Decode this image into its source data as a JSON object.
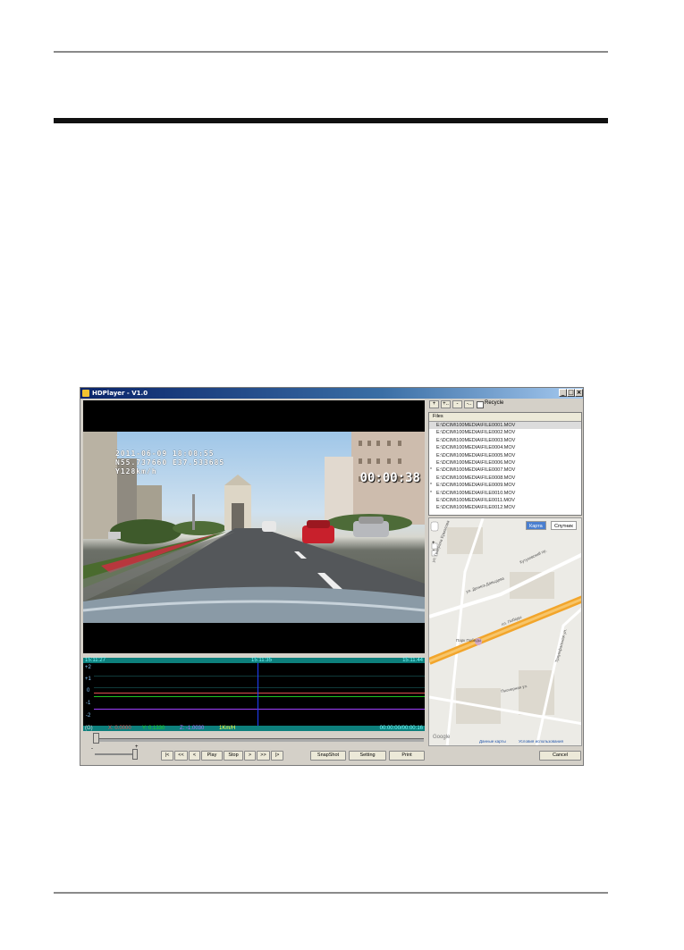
{
  "window": {
    "title": "HDPlayer - V1.0",
    "min": "_",
    "max": "□",
    "close": "×"
  },
  "video": {
    "osd_lines": [
      "2011-06-09 18:08:55",
      "N55.737660 E37.533685",
      "Y128km/h"
    ],
    "timecode": "00:00:38"
  },
  "graph": {
    "time_left": "15:11:27",
    "time_mid": "15:11:35",
    "time_right": "15:11:44",
    "y_ticks": [
      "+2",
      "+1",
      "0",
      "-1",
      "-2"
    ],
    "status": {
      "g_label": "(G)",
      "x_val": "X: 0.0000",
      "y_val": "Y: 0.1330",
      "z_val": "Z: -1.0030",
      "speed": "1Km/H",
      "range": "00:00:00/00:00:16"
    }
  },
  "volume": {
    "minus": "-",
    "plus": "+"
  },
  "controls": {
    "first": "|<",
    "rewind": "<<",
    "back": "<",
    "play": "Play",
    "stop": "Stop",
    "forward": ">",
    "fast_forward": ">>",
    "last": "|>",
    "snapshot": "SnapShot",
    "setting": "Setting",
    "print": "Print",
    "cancel": "Cancel"
  },
  "file_toolbar": {
    "add": "+",
    "add_folder": "+..",
    "remove": "-",
    "remove_all": "-..",
    "recycle_label": "Recycle"
  },
  "files": {
    "header": "Files",
    "rows": [
      {
        "name": "E:\\DCIM\\100MEDIA\\FILE0001.MOV",
        "mark": ""
      },
      {
        "name": "E:\\DCIM\\100MEDIA\\FILE0002.MOV",
        "mark": ""
      },
      {
        "name": "E:\\DCIM\\100MEDIA\\FILE0003.MOV",
        "mark": ""
      },
      {
        "name": "E:\\DCIM\\100MEDIA\\FILE0004.MOV",
        "mark": ""
      },
      {
        "name": "E:\\DCIM\\100MEDIA\\FILE0005.MOV",
        "mark": ""
      },
      {
        "name": "E:\\DCIM\\100MEDIA\\FILE0006.MOV",
        "mark": ""
      },
      {
        "name": "E:\\DCIM\\100MEDIA\\FILE0007.MOV",
        "mark": "*"
      },
      {
        "name": "E:\\DCIM\\100MEDIA\\FILE0008.MOV",
        "mark": ""
      },
      {
        "name": "E:\\DCIM\\100MEDIA\\FILE0009.MOV",
        "mark": "*"
      },
      {
        "name": "E:\\DCIM\\100MEDIA\\FILE0010.MOV",
        "mark": "*"
      },
      {
        "name": "E:\\DCIM\\100MEDIA\\FILE0011.MOV",
        "mark": ""
      },
      {
        "name": "E:\\DCIM\\100MEDIA\\FILE0012.MOV",
        "mark": ""
      }
    ]
  },
  "map": {
    "tab_map": "Карта",
    "tab_satellite": "Спутник",
    "streets": [
      "ул. Генерала Ермолова",
      "ул. Дениса Давыдова",
      "пл. Победы",
      "Кутузовский пр.",
      "Пионерная ул.",
      "Триумфальная ул."
    ],
    "poi": "Парк Победы",
    "link_data": "Данные карты",
    "link_terms": "Условия использования",
    "logo": "Google"
  },
  "colors": {
    "graph_band": "#0d7f7c",
    "line_x": "#e05050",
    "line_y": "#20c020",
    "line_z": "#a040ff",
    "cursor": "#2040ff",
    "map_road": "#f2a52b"
  }
}
